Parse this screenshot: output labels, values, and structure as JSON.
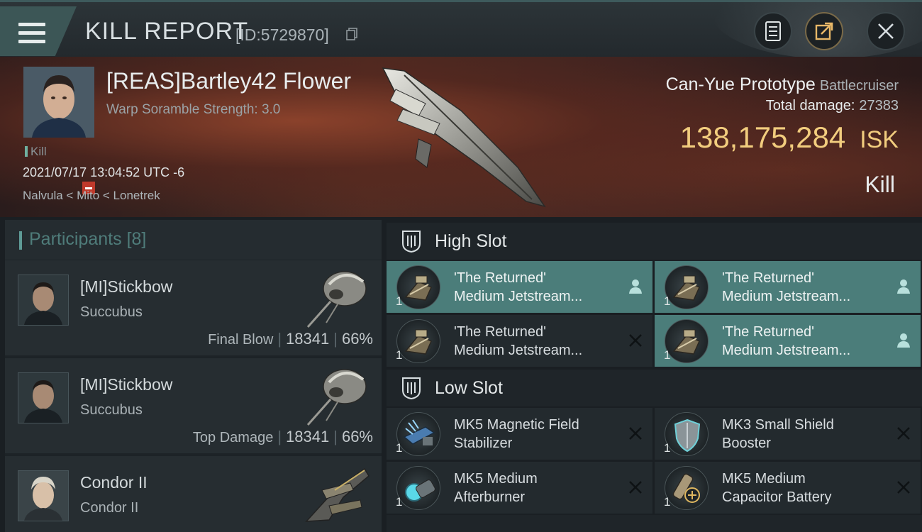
{
  "header": {
    "title": "KILL REPORT",
    "report_id": "[ID:5729870]"
  },
  "victim": {
    "name": "[REAS]Bartley42 Flower",
    "subtitle": "Warp Soramble Strength: 3.0",
    "tag": "Kill",
    "datetime": "2021/07/17 13:04:52 UTC -6",
    "location": "Nalvula < Mito < Lonetrek",
    "ship_name": "Can-Yue Prototype",
    "ship_class": "Battlecruiser",
    "total_damage_label": "Total damage:",
    "total_damage": "27383",
    "isk_value": "138,175,284",
    "isk_unit": "ISK",
    "result": "Kill"
  },
  "participants": {
    "label": "Participants",
    "count": "[8]",
    "items": [
      {
        "name": "[MI]Stickbow",
        "ship": "Succubus",
        "stat_label": "Final Blow",
        "damage": "18341",
        "percent": "66%"
      },
      {
        "name": "[MI]Stickbow",
        "ship": "Succubus",
        "stat_label": "Top Damage",
        "damage": "18341",
        "percent": "66%"
      },
      {
        "name": "Condor II",
        "ship": "Condor II"
      }
    ]
  },
  "slots": {
    "high": {
      "label": "High Slot",
      "modules": [
        {
          "line1": "'The Returned'",
          "line2": "Medium Jetstream...",
          "qty": "1",
          "state": "person-icon"
        },
        {
          "line1": "'The Returned'",
          "line2": "Medium Jetstream...",
          "qty": "1",
          "state": "person-icon"
        },
        {
          "line1": "'The Returned'",
          "line2": "Medium Jetstream...",
          "qty": "1",
          "state": "close-icon"
        },
        {
          "line1": "'The Returned'",
          "line2": "Medium Jetstream...",
          "qty": "1",
          "state": "person-icon"
        }
      ]
    },
    "low": {
      "label": "Low Slot",
      "modules": [
        {
          "line1": "MK5 Magnetic Field",
          "line2": "Stabilizer",
          "qty": "1",
          "state": "close-icon"
        },
        {
          "line1": "MK3 Small Shield",
          "line2": "Booster",
          "qty": "1",
          "state": "close-icon"
        },
        {
          "line1": "MK5 Medium",
          "line2": "Afterburner",
          "qty": "1",
          "state": "close-icon"
        },
        {
          "line1": "MK5 Medium",
          "line2": "Capacitor Battery",
          "qty": "1",
          "state": "close-icon"
        }
      ]
    }
  },
  "colors": {
    "accent": "#4b7d7a",
    "isk": "#f2cd7e",
    "destroyed_badge": "#c0392b"
  }
}
